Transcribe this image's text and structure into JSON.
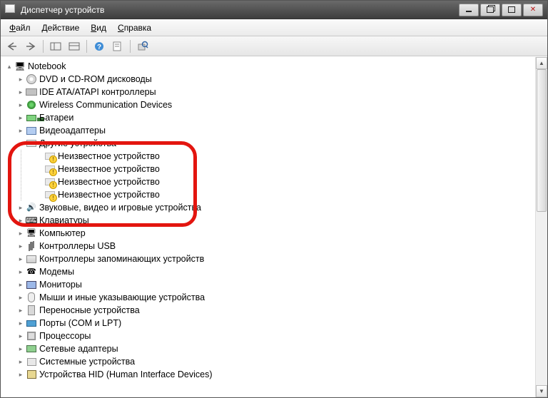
{
  "window": {
    "title": "Диспетчер устройств"
  },
  "menu": {
    "file": {
      "mnemonic": "Ф",
      "rest": "айл"
    },
    "action": {
      "mnemonic": "Д",
      "rest": "ействие"
    },
    "view": {
      "mnemonic": "В",
      "rest": "ид"
    },
    "help": {
      "mnemonic": "С",
      "rest": "правка"
    }
  },
  "tree": {
    "root": "Notebook",
    "items": [
      {
        "label": "DVD и CD-ROM дисководы",
        "icon": "ic-cd"
      },
      {
        "label": "IDE ATA/ATAPI контроллеры",
        "icon": "ic-ide"
      },
      {
        "label": "Wireless Communication Devices",
        "icon": "ic-wireless"
      },
      {
        "label": "Батареи",
        "icon": "ic-battery"
      },
      {
        "label": "Видеоадаптеры",
        "icon": "ic-display"
      },
      {
        "label": "Другие устройства",
        "icon": "ic-other",
        "expanded": true,
        "children": [
          {
            "label": "Неизвестное устройство",
            "icon": "ic-unknown"
          },
          {
            "label": "Неизвестное устройство",
            "icon": "ic-unknown"
          },
          {
            "label": "Неизвестное устройство",
            "icon": "ic-unknown"
          },
          {
            "label": "Неизвестное устройство",
            "icon": "ic-unknown"
          }
        ]
      },
      {
        "label": "Звуковые, видео и игровые устройства",
        "icon": "ic-sound"
      },
      {
        "label": "Клавиатуры",
        "icon": "ic-keyboard"
      },
      {
        "label": "Компьютер",
        "icon": "ic-pc"
      },
      {
        "label": "Контроллеры USB",
        "icon": "ic-usb"
      },
      {
        "label": "Контроллеры запоминающих устройств",
        "icon": "ic-storage"
      },
      {
        "label": "Модемы",
        "icon": "ic-modem"
      },
      {
        "label": "Мониторы",
        "icon": "ic-monitor"
      },
      {
        "label": "Мыши и иные указывающие устройства",
        "icon": "ic-mouse"
      },
      {
        "label": "Переносные устройства",
        "icon": "ic-portable"
      },
      {
        "label": "Порты (COM и LPT)",
        "icon": "ic-port"
      },
      {
        "label": "Процессоры",
        "icon": "ic-cpu"
      },
      {
        "label": "Сетевые адаптеры",
        "icon": "ic-net"
      },
      {
        "label": "Системные устройства",
        "icon": "ic-system"
      },
      {
        "label": "Устройства HID (Human Interface Devices)",
        "icon": "ic-hid"
      }
    ]
  },
  "annotation": {
    "highlighted_category": "Другие устройства"
  }
}
